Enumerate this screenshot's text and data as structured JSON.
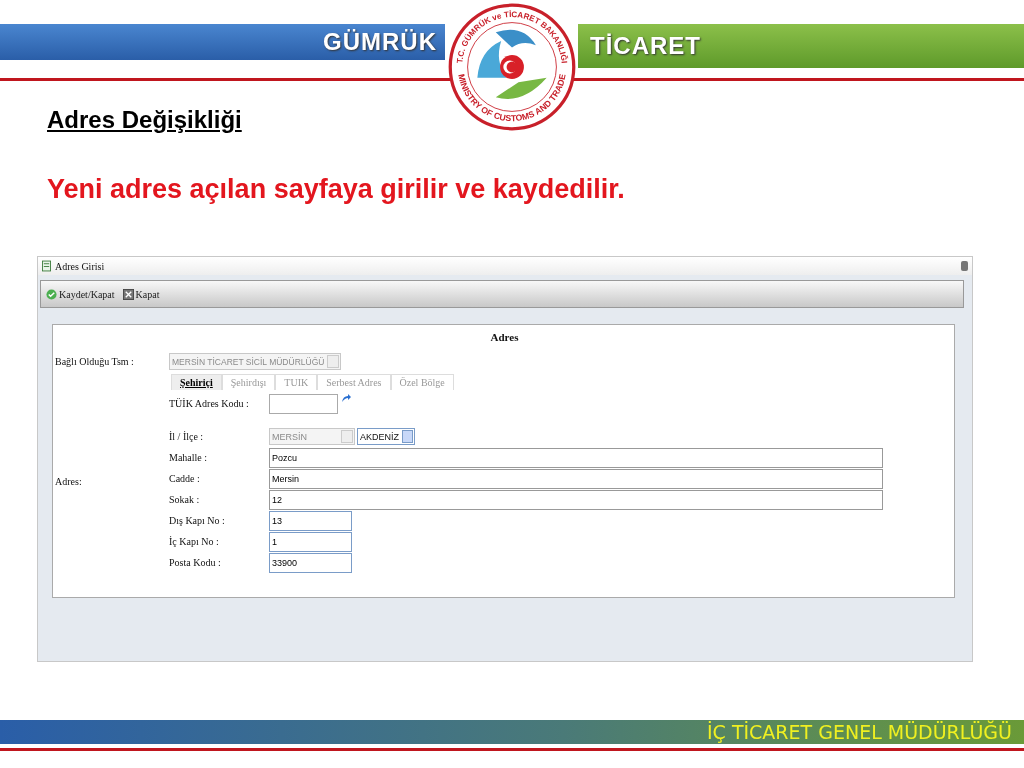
{
  "header": {
    "left_label": "GÜMRÜK",
    "right_label": "TİCARET",
    "logo": {
      "top_text": "T.C. GÜMRÜK ve TİCARET BAKANLIĞI",
      "bottom_text": "MINISTRY OF CUSTOMS AND TRADE"
    }
  },
  "title": "Adres Değişikliği",
  "subtitle": "Yeni adres açılan sayfaya girilir ve kaydedilir.",
  "app": {
    "window_title": "Adres Girisi",
    "toolbar": [
      {
        "label": "Kaydet/Kapat",
        "kind": "save"
      },
      {
        "label": "Kapat",
        "kind": "close"
      }
    ],
    "panel_title": "Adres",
    "unit": {
      "label": "Bağlı Olduğu Tsm :",
      "value": "MERSİN TİCARET SİCİL MÜDÜRLÜĞÜ",
      "disabled": true
    },
    "address_label": "Adres:",
    "tabs": [
      {
        "label": "Şehiriçi",
        "selected": true
      },
      {
        "label": "Şehirdışı",
        "selected": false
      },
      {
        "label": "TUIK",
        "selected": false
      },
      {
        "label": "Serbest Adres",
        "selected": false
      },
      {
        "label": "Özel Bölge",
        "selected": false
      }
    ],
    "fields": [
      {
        "kind": "code",
        "label": "TÜİK Adres Kodu :"
      },
      {
        "kind": "selects",
        "label": "İl / İlçe :",
        "selects": [
          {
            "value": "MERSİN",
            "disabled": true
          },
          {
            "value": "AKDENİZ",
            "disabled": false
          }
        ]
      },
      {
        "kind": "wide",
        "label": "Mahalle :",
        "value": "Pozcu"
      },
      {
        "kind": "wide",
        "label": "Cadde :",
        "value": "Mersin"
      },
      {
        "kind": "wide",
        "label": "Sokak :",
        "value": "12"
      },
      {
        "kind": "short",
        "label": "Dış Kapı No :",
        "value": "13"
      },
      {
        "kind": "short",
        "label": "İç Kapı No :",
        "value": "1"
      },
      {
        "kind": "short",
        "label": "Posta Kodu :",
        "value": "33900"
      }
    ]
  },
  "footer": {
    "text": "İÇ TİCARET GENEL MÜDÜRLÜĞÜ"
  }
}
